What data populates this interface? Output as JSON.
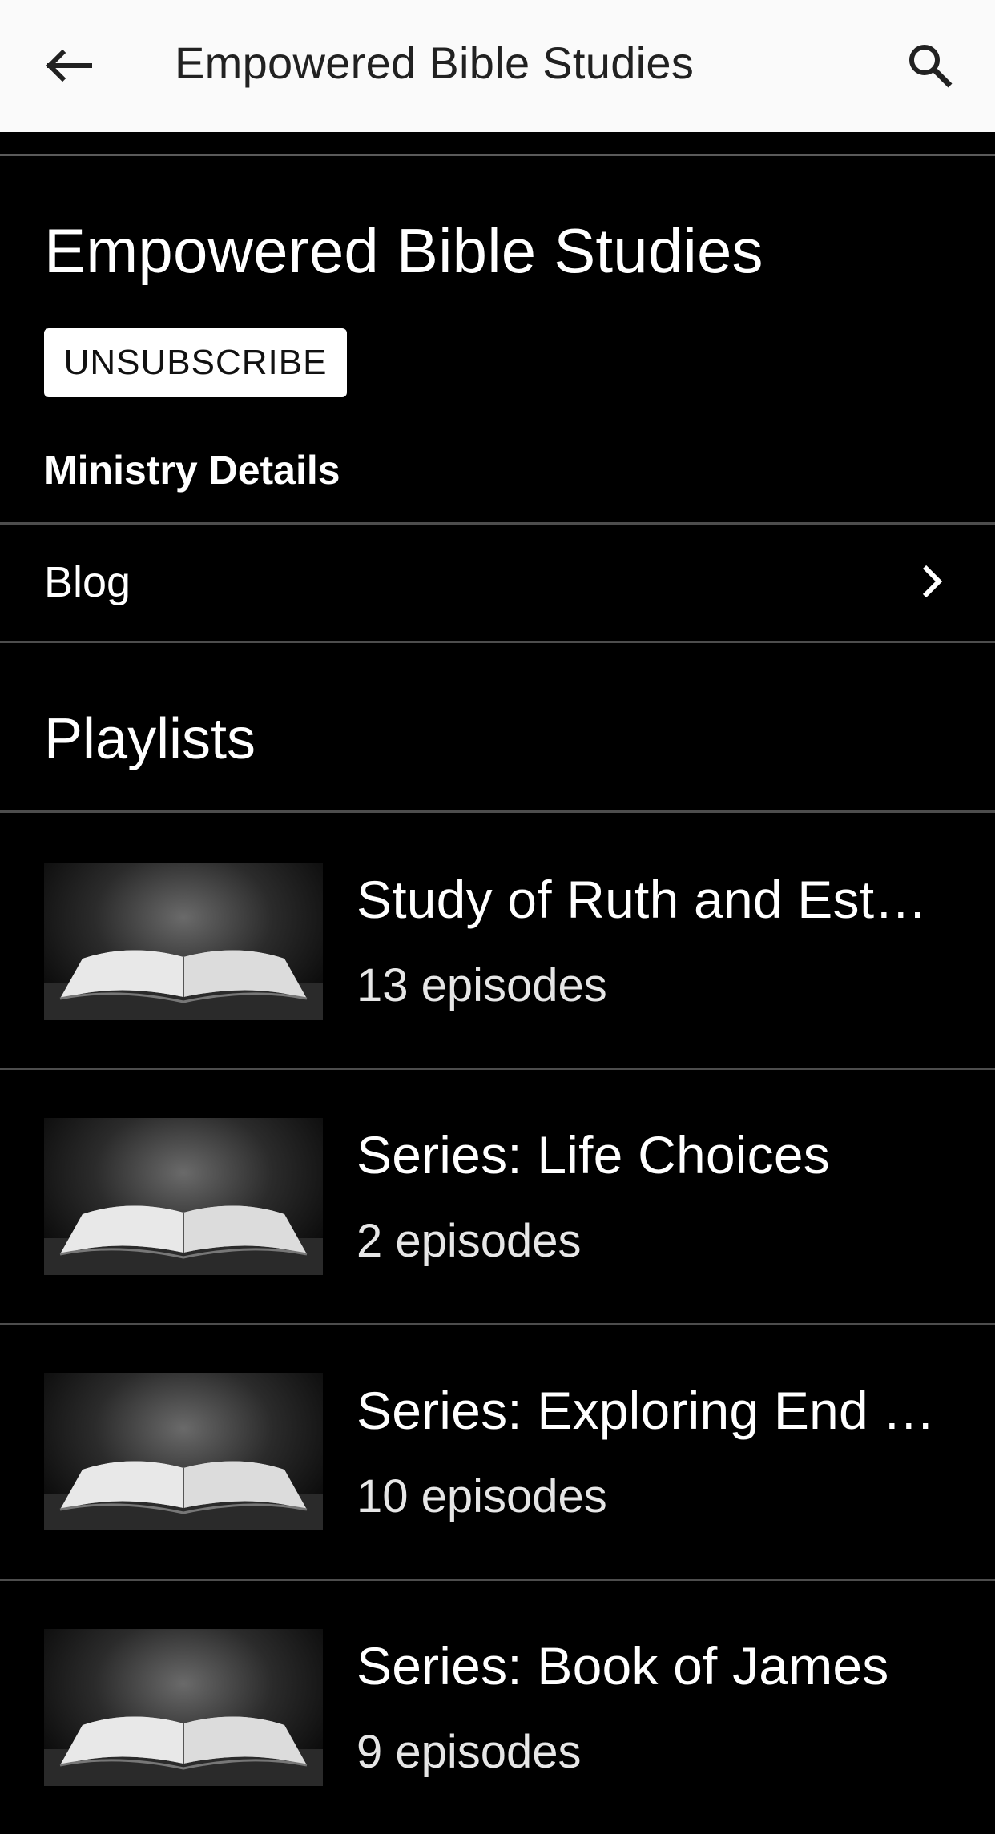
{
  "app_bar": {
    "title": "Empowered Bible Studies",
    "back_icon": "arrow-left-icon",
    "search_icon": "search-icon"
  },
  "header": {
    "title": "Empowered Bible Studies",
    "unsubscribe_label": "UNSUBSCRIBE",
    "ministry_details_label": "Ministry Details"
  },
  "links": [
    {
      "label": "Blog",
      "icon": "chevron-right-icon"
    }
  ],
  "playlists": {
    "heading": "Playlists",
    "items": [
      {
        "title": "Study of Ruth and Esth…",
        "episodes": "13 episodes"
      },
      {
        "title": "Series: Life Choices",
        "episodes": "2 episodes"
      },
      {
        "title": "Series: Exploring End T…",
        "episodes": "10 episodes"
      },
      {
        "title": "Series: Book of James",
        "episodes": "9 episodes"
      }
    ]
  },
  "colors": {
    "app_bar_bg": "#fafafa",
    "page_bg": "#000000",
    "divider": "#4d4d4d",
    "text_primary": "#ffffff"
  }
}
